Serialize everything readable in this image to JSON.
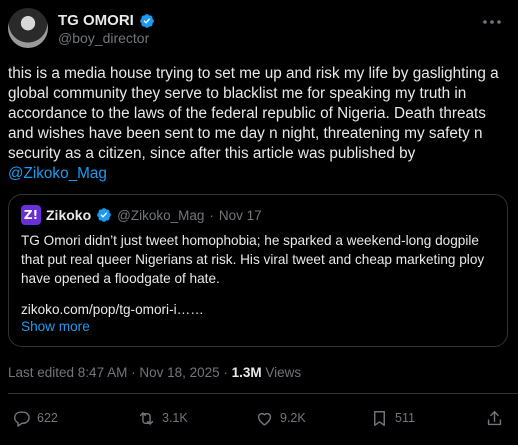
{
  "author": {
    "display_name": "TG OMORI",
    "handle": "@boy_director",
    "verified_icon": "verified-badge-icon",
    "verified_color": "#1d9bf0"
  },
  "post": {
    "text": "this is a media house trying to set me up and risk my life by gaslighting a global community they serve to blacklist me for speaking my truth in accordance to the laws of the federal republic of Nigeria. Death threats and wishes have been sent to me day n night, threatening my safety n security as a citizen, since after this article was published by ",
    "mention": "@Zikoko_Mag"
  },
  "quote": {
    "logo_text": "Z!",
    "logo_color": "#6b2fd6",
    "name": "Zikoko",
    "handle": "@Zikoko_Mag",
    "separator": "·",
    "date": "Nov 17",
    "text": "TG Omori didn’t just tweet homophobia; he sparked a weekend-long dogpile that put real queer Nigerians at risk. His viral tweet and cheap marketing ploy have opened a floodgate of hate.",
    "link": "zikoko.com/pop/tg-omori-i……",
    "show_more": "Show more"
  },
  "meta": {
    "edited": "Last edited 8:47 AM · Nov 18, 2025 · ",
    "views_count": "1.3M",
    "views_label": " Views"
  },
  "actions": {
    "replies": "622",
    "reposts": "3.1K",
    "likes": "9.2K",
    "bookmarks": "511"
  },
  "colors": {
    "background": "#000000",
    "text": "#e7e9ea",
    "muted": "#71767b",
    "accent": "#1d9bf0",
    "border": "#2f3336"
  }
}
